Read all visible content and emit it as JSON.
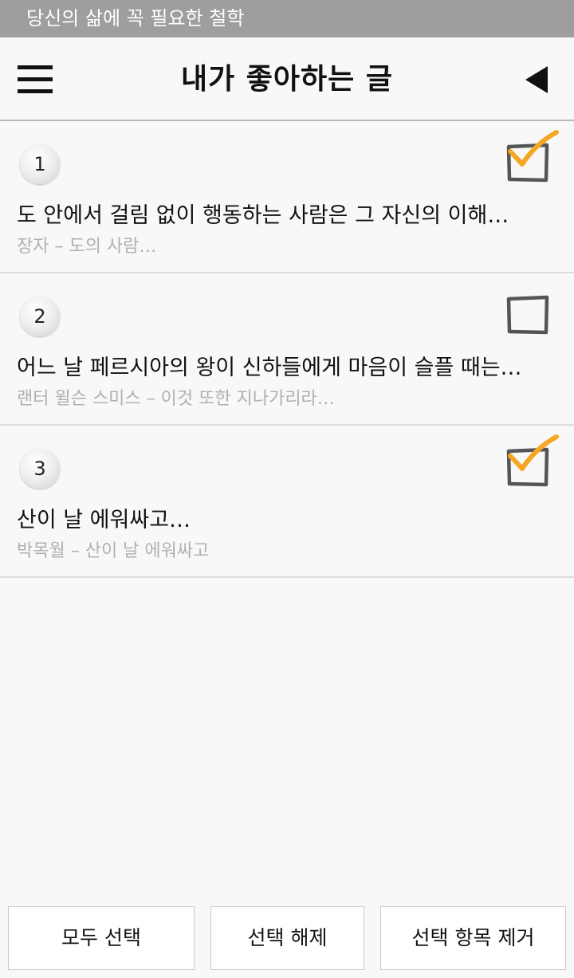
{
  "status_bar": {
    "text": "당신의 삶에 꼭 필요한 철학"
  },
  "header": {
    "title": "내가 좋아하는 글"
  },
  "items": [
    {
      "number": "1",
      "title": "도 안에서 걸림 없이 행동하는 사람은 그 자신의 이해…",
      "subtitle": "장자 – 도의 사람…",
      "checked": true
    },
    {
      "number": "2",
      "title": "어느 날 페르시아의 왕이 신하들에게 마음이 슬플 때는…",
      "subtitle": "랜터 윌슨 스미스 – 이것 또한 지나가리라…",
      "checked": false
    },
    {
      "number": "3",
      "title": "산이 날 에워싸고…",
      "subtitle": "박목월 – 산이 날 에워싸고",
      "checked": true
    }
  ],
  "footer": {
    "select_all": "모두 선택",
    "deselect": "선택 해제",
    "remove_selected": "선택 항목 제거"
  },
  "colors": {
    "status_bar": "#9e9e9e",
    "check_mark": "#f5a623",
    "subtitle": "#b0b0b0"
  }
}
